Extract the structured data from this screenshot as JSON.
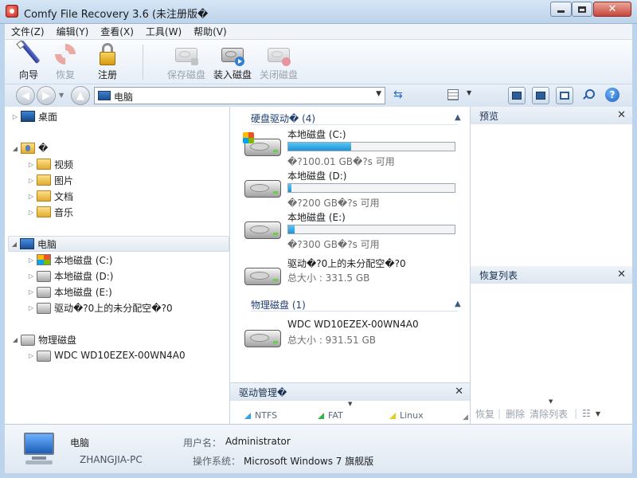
{
  "window": {
    "title": "Comfy File Recovery 3.6 (未注册版�"
  },
  "menu": [
    "文件(Z)",
    "编辑(Y)",
    "查看(X)",
    "工具(W)",
    "帮助(V)"
  ],
  "toolbar": {
    "wizard": "向导",
    "recover": "恢复",
    "register": "注册",
    "save_disk": "保存磁盘",
    "load_disk": "装入磁盘",
    "close_disk": "关闭磁盘"
  },
  "address": {
    "text": "电脑"
  },
  "tree": {
    "desktop": "桌面",
    "user": "�",
    "videos": "视频",
    "pictures": "图片",
    "documents": "文档",
    "music": "音乐",
    "computer": "电脑",
    "drive_c": "本地磁盘 (C:)",
    "drive_d": "本地磁盘 (D:)",
    "drive_e": "本地磁盘 (E:)",
    "unallocated": "驱动�?0上的未分配空�?0",
    "physical": "物理磁盘",
    "wdc": "WDC WD10EZEX-00WN4A0"
  },
  "center": {
    "hdd_group": "硬盘驱动� (4)",
    "phys_group": "物理磁盘 (1)",
    "drives": [
      {
        "name": "本地磁盘 (C:)",
        "free": "�?100.01 GB�?s 可用",
        "fill": 0.38
      },
      {
        "name": "本地磁盘 (D:)",
        "free": "�?200 GB�?s 可用",
        "fill": 0.02
      },
      {
        "name": "本地磁盘 (E:)",
        "free": "�?300 GB�?s 可用",
        "fill": 0.04
      }
    ],
    "unalloc": {
      "name": "驱动�?0上的未分配空�?0",
      "size": "总大小 : 331.5 GB"
    },
    "physical": {
      "name": "WDC WD10EZEX-00WN4A0",
      "size": "总大小 : 931.51 GB"
    }
  },
  "drive_manager": {
    "title": "驱动管理�",
    "legend": [
      {
        "label": "NTFS",
        "color": "#3aa0e0"
      },
      {
        "label": "FAT",
        "color": "#3ab04a"
      },
      {
        "label": "Linux",
        "color": "#e0d020"
      }
    ]
  },
  "preview": {
    "title": "预览"
  },
  "recovery_list": {
    "title": "恢复列表",
    "recover": "恢复",
    "delete": "删除",
    "clear": "清除列表"
  },
  "status": {
    "computer": "电脑",
    "host": "ZHANGJIA-PC",
    "user_label": "用户名：",
    "user": "Administrator",
    "os_label": "操作系统：",
    "os": "Microsoft Windows 7 旗舰版"
  }
}
